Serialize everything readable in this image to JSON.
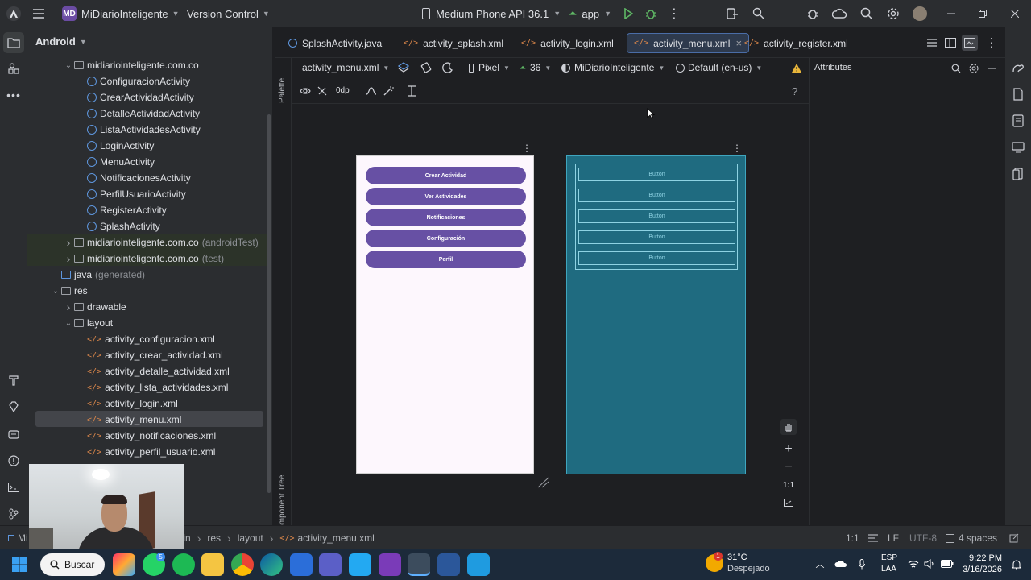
{
  "titlebar": {
    "project_badge": "MD",
    "project_name": "MiDiarioInteligente",
    "vcs": "Version Control",
    "device": "Medium Phone API 36.1",
    "run_config": "app"
  },
  "project_panel": {
    "view_label": "Android",
    "tree": [
      {
        "label": "midiariointeligente.com.co",
        "type": "package",
        "expanded": true
      },
      {
        "label": "ConfiguracionActivity",
        "type": "class"
      },
      {
        "label": "CrearActividadActivity",
        "type": "class"
      },
      {
        "label": "DetalleActividadActivity",
        "type": "class"
      },
      {
        "label": "ListaActividadesActivity",
        "type": "class"
      },
      {
        "label": "LoginActivity",
        "type": "class"
      },
      {
        "label": "MenuActivity",
        "type": "class"
      },
      {
        "label": "NotificacionesActivity",
        "type": "class"
      },
      {
        "label": "PerfilUsuarioActivity",
        "type": "class"
      },
      {
        "label": "RegisterActivity",
        "type": "class"
      },
      {
        "label": "SplashActivity",
        "type": "class"
      },
      {
        "label": "midiariointeligente.com.co",
        "suffix": "(androidTest)",
        "type": "package"
      },
      {
        "label": "midiariointeligente.com.co",
        "suffix": "(test)",
        "type": "package"
      },
      {
        "label": "java",
        "suffix": "(generated)",
        "type": "folder"
      },
      {
        "label": "res",
        "type": "folder"
      },
      {
        "label": "drawable",
        "type": "folder"
      },
      {
        "label": "layout",
        "type": "folder"
      },
      {
        "label": "activity_configuracion.xml",
        "type": "xml"
      },
      {
        "label": "activity_crear_actividad.xml",
        "type": "xml"
      },
      {
        "label": "activity_detalle_actividad.xml",
        "type": "xml"
      },
      {
        "label": "activity_lista_actividades.xml",
        "type": "xml"
      },
      {
        "label": "activity_login.xml",
        "type": "xml"
      },
      {
        "label": "activity_menu.xml",
        "type": "xml"
      },
      {
        "label": "activity_notificaciones.xml",
        "type": "xml"
      },
      {
        "label": "activity_perfil_usuario.xml",
        "type": "xml"
      }
    ]
  },
  "tabs": [
    {
      "label": "SplashActivity.java",
      "kind": "java"
    },
    {
      "label": "activity_splash.xml",
      "kind": "xml"
    },
    {
      "label": "activity_login.xml",
      "kind": "xml"
    },
    {
      "label": "activity_menu.xml",
      "kind": "xml",
      "active": true
    },
    {
      "label": "activity_register.xml",
      "kind": "xml"
    }
  ],
  "design_toolbar": {
    "file": "activity_menu.xml",
    "device": "Pixel",
    "api": "36",
    "theme": "MiDiarioInteligente",
    "locale": "Default (en-us)",
    "margin": "0dp",
    "help": "?",
    "attributes": "Attributes",
    "palette": "Palette",
    "component_tree": "Component Tree"
  },
  "preview": {
    "buttons": [
      "Crear Actividad",
      "Ver Actividades",
      "Notificaciones",
      "Configuración",
      "Perfil"
    ],
    "blueprint_label": "Button",
    "accent": "#6750a4",
    "zoom_label": "1:1"
  },
  "breadcrumb": [
    "Mi",
    "main",
    "res",
    "layout",
    "activity_menu.xml"
  ],
  "status": {
    "position": "1:1",
    "line_sep": "LF",
    "encoding": "UTF-8",
    "indent": "4 spaces"
  },
  "taskbar": {
    "search": "Buscar",
    "weather_temp": "31°C",
    "weather_desc": "Despejado",
    "lang": "ESP",
    "layout": "LAA",
    "time": "9:22 PM",
    "date": "3/16/2026",
    "badge_count": "5",
    "weather_badge": "1"
  }
}
